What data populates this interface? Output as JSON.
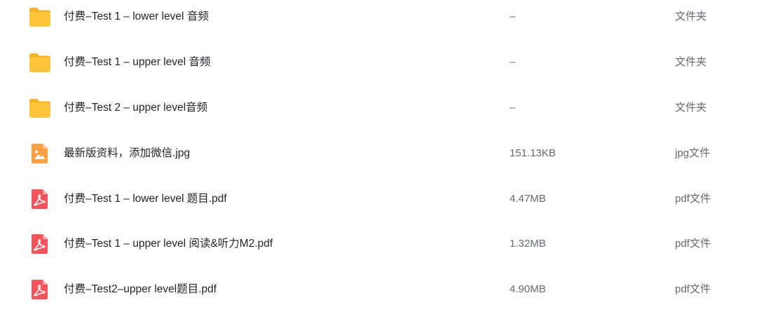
{
  "colors": {
    "folder": "#FFC53D",
    "folder_back": "#F7B32B",
    "image_file": "#FF9F43",
    "pdf_file": "#F5545C",
    "text_primary": "#1f2329",
    "text_secondary": "#646a73"
  },
  "files": [
    {
      "icon": "folder-icon",
      "name": "付费–Test 1 – lower level 音频",
      "size": "–",
      "type": "文件夹"
    },
    {
      "icon": "folder-icon",
      "name": "付费–Test 1 – upper level 音频",
      "size": "–",
      "type": "文件夹"
    },
    {
      "icon": "folder-icon",
      "name": "付费–Test 2 – upper level音频",
      "size": "–",
      "type": "文件夹"
    },
    {
      "icon": "image-file-icon",
      "name": "最新版资料，添加微信.jpg",
      "size": "151.13KB",
      "type": "jpg文件"
    },
    {
      "icon": "pdf-file-icon",
      "name": "付费–Test 1 – lower level 题目.pdf",
      "size": "4.47MB",
      "type": "pdf文件"
    },
    {
      "icon": "pdf-file-icon",
      "name": "付费–Test 1 – upper level 阅读&听力M2.pdf",
      "size": "1.32MB",
      "type": "pdf文件"
    },
    {
      "icon": "pdf-file-icon",
      "name": "付费–Test2–upper level题目.pdf",
      "size": "4.90MB",
      "type": "pdf文件"
    }
  ]
}
